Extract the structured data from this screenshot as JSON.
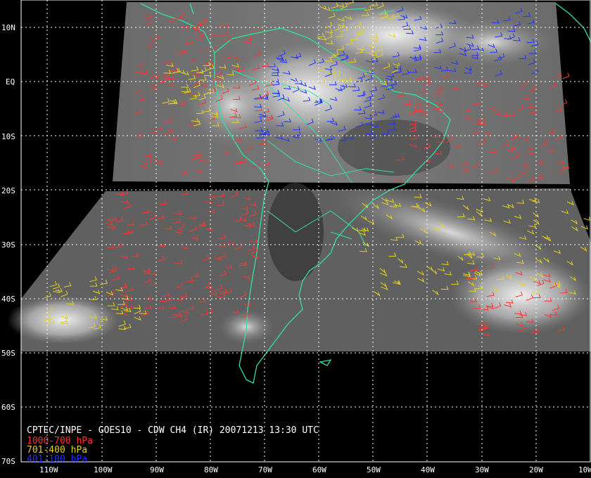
{
  "product": {
    "title": "CPTEC/INPE - GOES10 - CDW CH4 (IR) 20071213 13:30 UTC"
  },
  "legend": [
    {
      "label": "1000-700 hPa",
      "color": "#ff3333"
    },
    {
      "label": "701-400 hPa",
      "color": "#e6d21e"
    },
    {
      "label": "401-100 hPa",
      "color": "#2233ff"
    }
  ],
  "colors": {
    "background": "#000000",
    "coastline": "#33e0a0",
    "grid": "#ffffff",
    "cloud_field": "#5a5a5a"
  },
  "latitude_labels": [
    "10N",
    "EQ",
    "10S",
    "20S",
    "30S",
    "40S",
    "50S",
    "60S",
    "70S"
  ],
  "longitude_labels": [
    "110W",
    "100W",
    "90W",
    "80W",
    "70W",
    "60W",
    "50W",
    "40W",
    "30W",
    "20W",
    "10W"
  ]
}
